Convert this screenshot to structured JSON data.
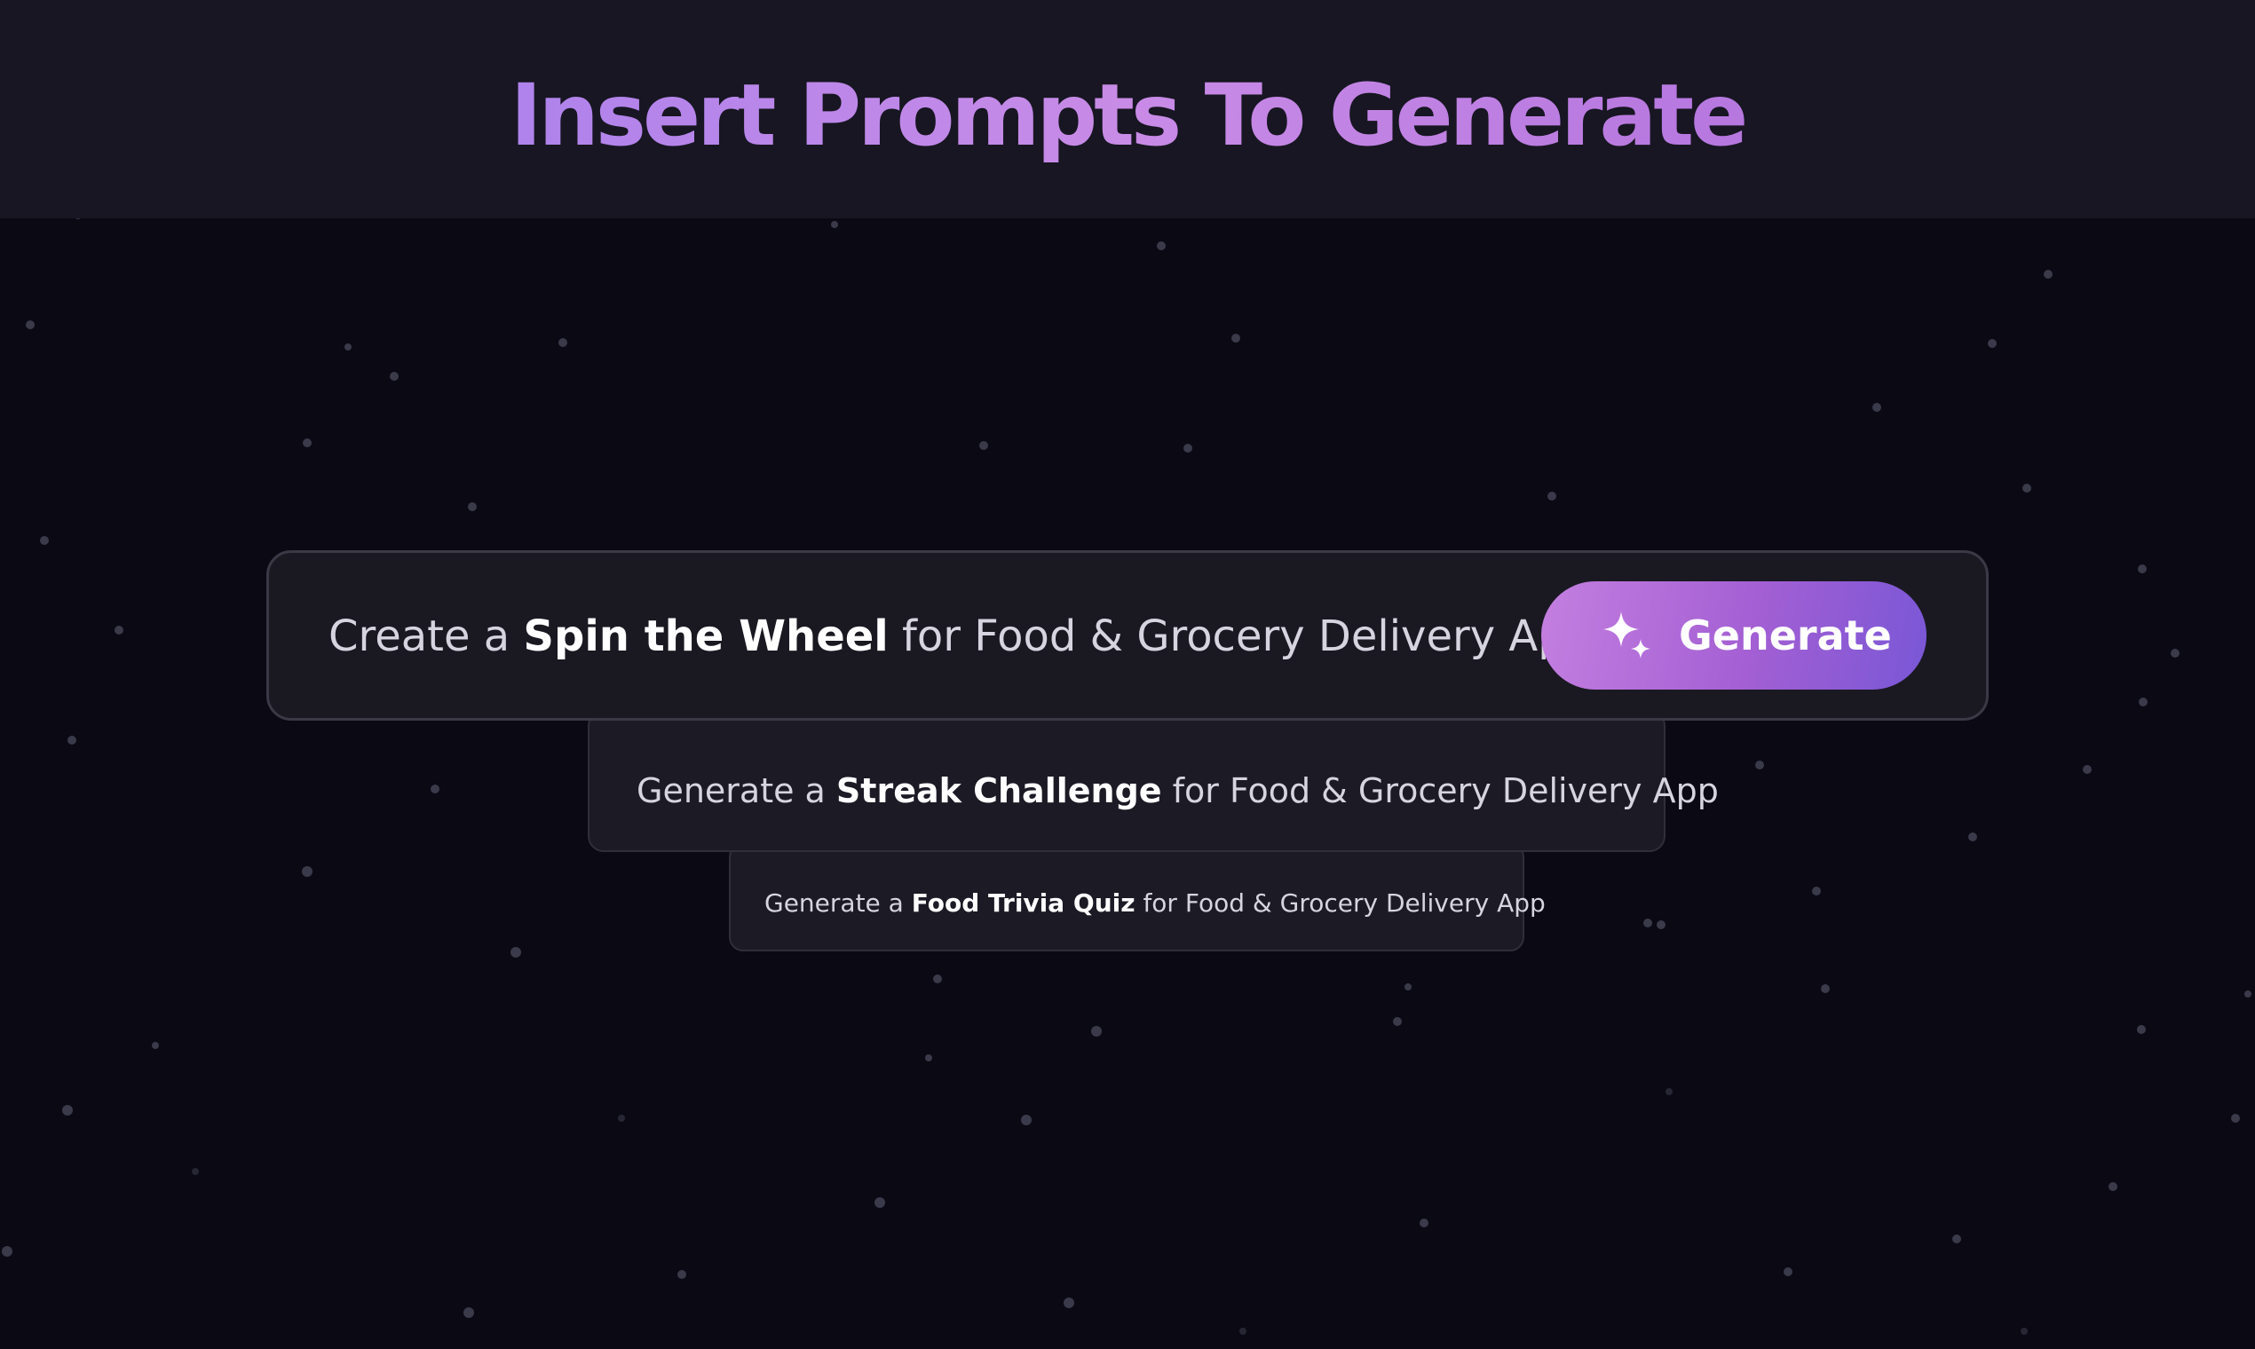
{
  "header": {
    "title": "Insert Prompts To Generate"
  },
  "prompts": [
    {
      "prefix": "Create a ",
      "highlight": "Spin the Wheel",
      "suffix": " for Food & Grocery Delivery App"
    },
    {
      "prefix": "Generate a ",
      "highlight": "Streak Challenge",
      "suffix": " for Food & Grocery Delivery App"
    },
    {
      "prefix": "Generate a ",
      "highlight": "Food Trivia Quiz",
      "suffix": " for Food & Grocery Delivery App"
    }
  ],
  "generate_button": {
    "label": "Generate",
    "icon": "sparkles-icon"
  },
  "colors": {
    "background": "#0a0914",
    "header_background": "#171622",
    "card_background": "#1a1922",
    "title_gradient_start": "#9a7cf0",
    "title_gradient_end": "#a766d9",
    "button_gradient_start": "#c47fe0",
    "button_gradient_end": "#7957d6"
  }
}
